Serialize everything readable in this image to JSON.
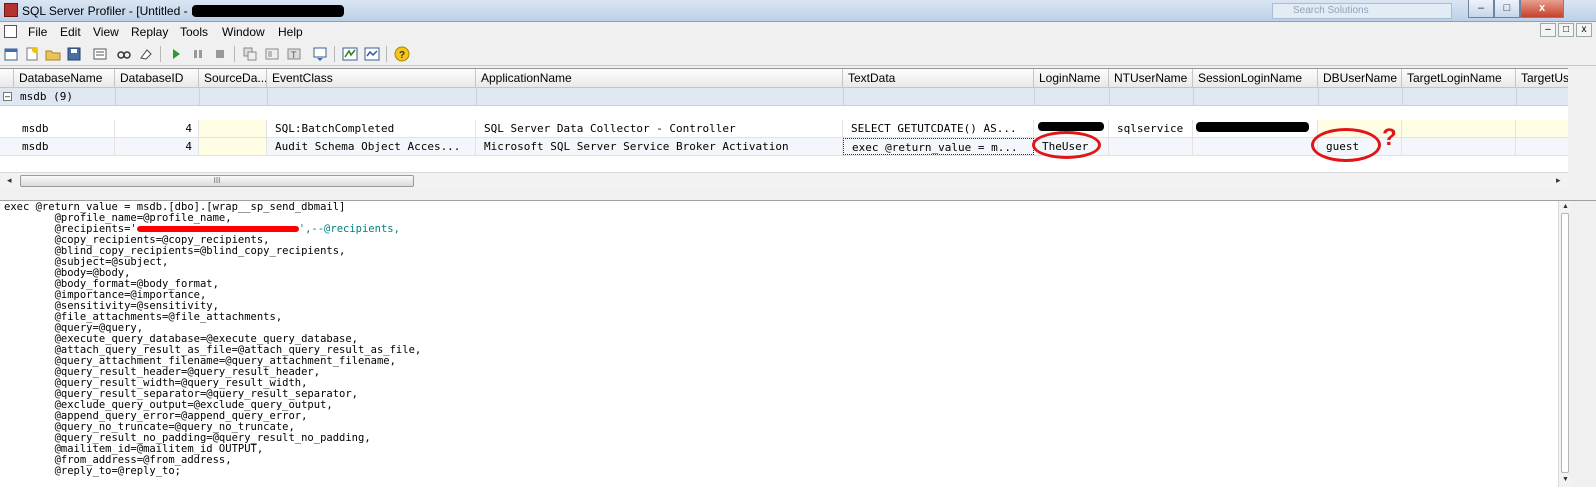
{
  "window": {
    "title": "SQL Server Profiler - [Untitled - 1",
    "search_placeholder": "Search Solutions"
  },
  "window_buttons": {
    "minimize": "–",
    "maximize": "□",
    "close": "x"
  },
  "menu": {
    "items": [
      "File",
      "Edit",
      "View",
      "Replay",
      "Tools",
      "Window",
      "Help"
    ]
  },
  "mdi_buttons": {
    "minimize": "–",
    "restore": "□",
    "close": "x"
  },
  "toolbar": {
    "icons": [
      "new-trace-icon",
      "new-template-icon",
      "open-icon",
      "save-icon",
      "properties-icon",
      "find-icon",
      "clear-icon",
      "run-icon",
      "pause-icon",
      "stop-icon",
      "auto-scroll-icon",
      "template-icon",
      "trace-properties-icon",
      "scroll-icon",
      "sql-profiler-icon",
      "perfmon-icon",
      "help-icon"
    ],
    "help_glyph": "?"
  },
  "grid": {
    "columns": [
      "DatabaseName",
      "DatabaseID",
      "SourceDa...",
      "EventClass",
      "ApplicationName",
      "TextData",
      "LoginName",
      "NTUserName",
      "SessionLoginName",
      "DBUserName",
      "TargetLoginName",
      "TargetUs"
    ],
    "group": {
      "expander": "–",
      "label": "msdb (9)"
    },
    "rows": [
      {
        "DatabaseName": "msdb",
        "DatabaseID": "4",
        "SourceDatabaseID": "",
        "EventClass": "SQL:BatchCompleted",
        "ApplicationName": "SQL Server Data Collector - Controller",
        "TextData": "SELECT GETUTCDATE() AS...",
        "LoginName": "",
        "NTUserName": "sqlservice",
        "SessionLoginName": "",
        "DBUserName": ""
      },
      {
        "DatabaseName": "msdb",
        "DatabaseID": "4",
        "SourceDatabaseID": "",
        "EventClass": "Audit Schema Object Acces...",
        "ApplicationName": "Microsoft SQL Server Service Broker Activation",
        "TextData": "exec @return_value = m...",
        "LoginName": "TheUser",
        "NTUserName": "",
        "SessionLoginName": "",
        "DBUserName": "guest"
      }
    ]
  },
  "hscroll": {
    "left": "◂",
    "right": "▸",
    "grip": "III"
  },
  "vscroll": {
    "up": "▲",
    "down": "▼"
  },
  "annotation": {
    "question_mark": "?"
  },
  "textdata": {
    "lines": [
      "exec @return_value = msdb.[dbo].[wrap__sp_send_dbmail]",
      "        @profile_name=@profile_name,",
      "        @recipients='",
      "',--@recipients,",
      "        @copy_recipients=@copy_recipients,",
      "        @blind_copy_recipients=@blind_copy_recipients,",
      "        @subject=@subject,",
      "        @body=@body,",
      "        @body_format=@body_format,",
      "        @importance=@importance,",
      "        @sensitivity=@sensitivity,",
      "        @file_attachments=@file_attachments,",
      "        @query=@query,",
      "        @execute_query_database=@execute_query_database,",
      "        @attach_query_result_as_file=@attach_query_result_as_file,",
      "        @query_attachment_filename=@query_attachment_filename,",
      "        @query_result_header=@query_result_header,",
      "        @query_result_width=@query_result_width,",
      "        @query_result_separator=@query_result_separator,",
      "        @exclude_query_output=@exclude_query_output,",
      "        @append_query_error=@append_query_error,",
      "        @query_no_truncate=@query_no_truncate,",
      "        @query_result_no_padding=@query_result_no_padding,",
      "        @mailitem_id=@mailitem_id OUTPUT,",
      "        @from_address=@from_address,",
      "        @reply_to=@reply_to;"
    ]
  }
}
